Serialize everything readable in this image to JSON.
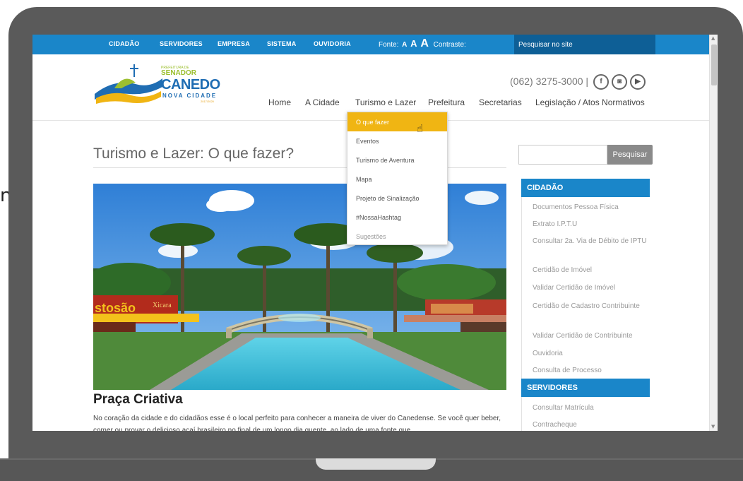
{
  "edge_char": "n",
  "topbar": {
    "items": [
      "CIDADÃO",
      "SERVIDORES",
      "EMPRESA",
      "SISTEMA",
      "OUVIDORIA"
    ],
    "font_label": "Fonte:",
    "font_sizes": [
      "A",
      "A",
      "A"
    ],
    "contrast_label": "Contraste:",
    "search_placeholder": "Pesquisar no site"
  },
  "logo": {
    "small": "PREFEITURA DE",
    "senador": "SENADOR",
    "canedo": "CANEDO",
    "nova": "NOVA CIDADE",
    "years": "2017/2020"
  },
  "header": {
    "phone": "(062) 3275-3000 |",
    "social": [
      {
        "icon": "facebook-icon",
        "glyph": "f"
      },
      {
        "icon": "instagram-icon",
        "glyph": "◙"
      },
      {
        "icon": "youtube-icon",
        "glyph": "▶"
      }
    ]
  },
  "main_nav": [
    "Home",
    "A Cidade",
    "Turismo e Lazer",
    "Prefeitura",
    "Secretarias",
    "Legislação / Atos Normativos"
  ],
  "dropdown": {
    "items": [
      "O que fazer",
      "Eventos",
      "Turismo de Aventura",
      "Mapa",
      "Projeto de Sinalização",
      "#NossaHashtag",
      "Sugestões"
    ],
    "active_index": 0
  },
  "content": {
    "title": "Turismo e Lazer: O que fazer?",
    "photo_signs": [
      "stosão",
      "Xicara"
    ],
    "section_title": "Praça Criativa",
    "paragraph": "No coração da cidade e do cidadãos esse é o local perfeito para conhecer a maneira de viver do Canedense. Se você quer beber, comer ou provar o delicioso açaí brasileiro no final de um longo dia quente, ao lado de uma fonte que"
  },
  "sidebar": {
    "search_button": "Pesquisar",
    "sections": [
      {
        "heading": "CIDADÃO",
        "items": [
          "Documentos Pessoa Física",
          "Extrato I.P.T.U",
          "Consultar 2a. Via de Débito de IPTU",
          "Certidão de Imóvel",
          "Validar Certidão de Imóvel",
          "Certidão de Cadastro Contribuinte",
          "Validar Certidão de Contribuinte",
          "Ouvidoria",
          "Consulta de Processo"
        ]
      },
      {
        "heading": "SERVIDORES",
        "items": [
          "Consultar Matrícula",
          "Contracheque"
        ]
      }
    ]
  },
  "colors": {
    "brand_blue": "#1a86c9",
    "search_dark_blue": "#0e5f96",
    "dropdown_active": "#f0b513",
    "frame_gray": "#5a5a5a"
  }
}
